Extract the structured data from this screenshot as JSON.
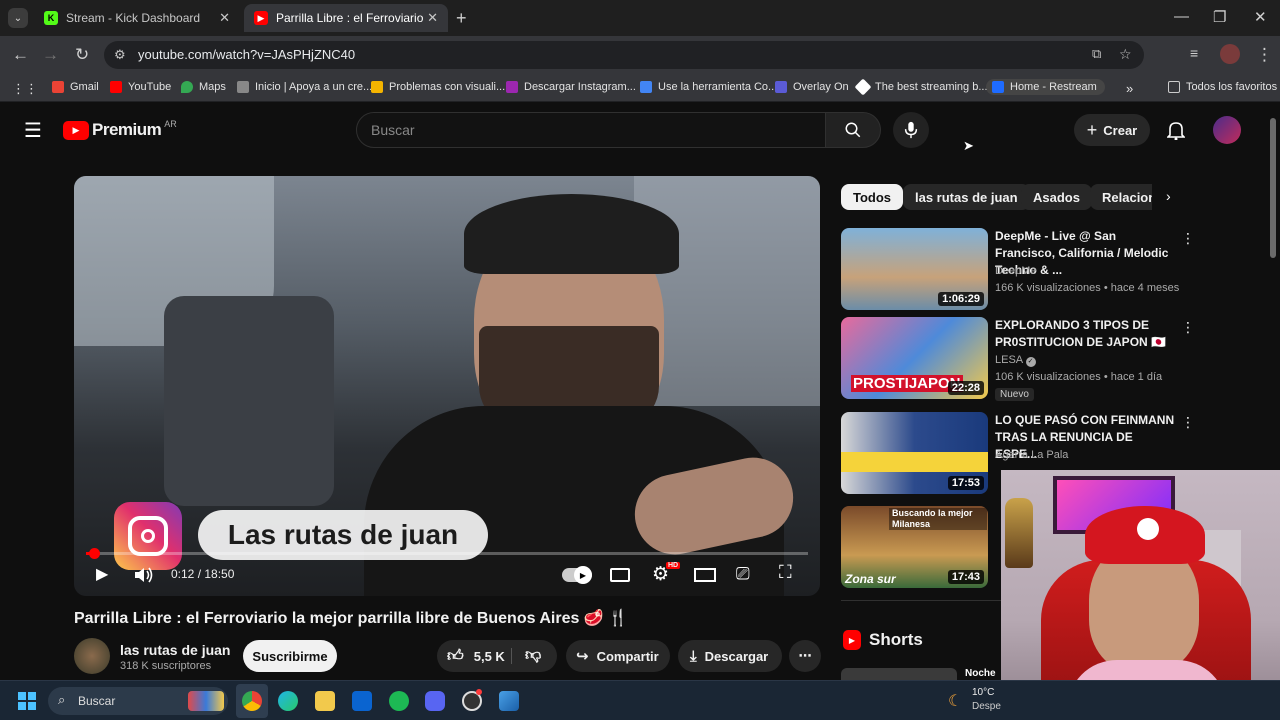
{
  "browser": {
    "tabs": [
      {
        "title": "Stream - Kick Dashboard",
        "active": false,
        "icon": "kick-icon"
      },
      {
        "title": "Parrilla Libre : el Ferroviario la mejor",
        "active": true,
        "icon": "youtube-icon"
      }
    ],
    "url": "youtube.com/watch?v=JAsPHjZNC40",
    "bookmarks": [
      {
        "label": "Gmail",
        "color": "#ea4335"
      },
      {
        "label": "YouTube",
        "color": "#ff0000"
      },
      {
        "label": "Maps",
        "color": "#34a853"
      },
      {
        "label": "Inicio | Apoya a un cre...",
        "color": "#cccccc"
      },
      {
        "label": "Problemas con visuali...",
        "color": "#f4b400"
      },
      {
        "label": "Descargar Instagram...",
        "color": "#9c27b0"
      },
      {
        "label": "Use la herramienta Co...",
        "color": "#4285f4"
      },
      {
        "label": "Overlay On",
        "color": "#5b5bd6"
      },
      {
        "label": "The best streaming b...",
        "color": "#ffffff"
      },
      {
        "label": "Home - Restream",
        "color": "#1e6bff"
      }
    ],
    "all_bookmarks": "Todos los favoritos"
  },
  "youtube": {
    "logo_text": "Premium",
    "country": "AR",
    "search_placeholder": "Buscar",
    "create_label": "Crear"
  },
  "player": {
    "overlay_text": "Las rutas de juan",
    "time": "0:12 / 18:50",
    "progress": 0.011,
    "hd_badge": "HD"
  },
  "video": {
    "title": "Parrilla Libre : el Ferroviario la mejor parrilla libre de Buenos Aires 🥩 🍴",
    "channel": "las rutas de juan",
    "subscribers": "318 K suscriptores",
    "subscribe_label": "Suscribirme",
    "likes": "5,5 K",
    "share_label": "Compartir",
    "download_label": "Descargar"
  },
  "chips": [
    "Todos",
    "las rutas de juan",
    "Asados",
    "Relacion"
  ],
  "recommendations": [
    {
      "title": "DeepMe - Live @ San Francisco, California  / Melodic Techno & ...",
      "channel": "DeepMe",
      "meta": "166 K visualizaciones • hace 4 meses",
      "duration": "1:06:29",
      "badge": ""
    },
    {
      "title": "EXPLORANDO 3 TIPOS DE PR0STITUCION DE JAPON 🇯🇵",
      "channel": "LESA",
      "meta": "106 K visualizaciones • hace 1 día",
      "duration": "22:28",
      "badge": "Nuevo",
      "thumb_text": "PROSTIJAPON"
    },
    {
      "title": "LO QUE PASÓ CON FEINMANN TRAS LA RENUNCIA DE ESPE...",
      "channel": "Agarrá La Pala",
      "meta": "",
      "duration": "17:53",
      "badge": ""
    },
    {
      "title": "",
      "channel": "",
      "meta": "",
      "duration": "17:43",
      "badge": "",
      "thumb_text": "Zona sur",
      "thumb_top": "Buscando la mejor Milanesa"
    }
  ],
  "shorts_label": "Shorts",
  "shorts_peek": "Noche",
  "taskbar": {
    "search": "Buscar",
    "temperature": "10°C",
    "weather": "Despe"
  }
}
